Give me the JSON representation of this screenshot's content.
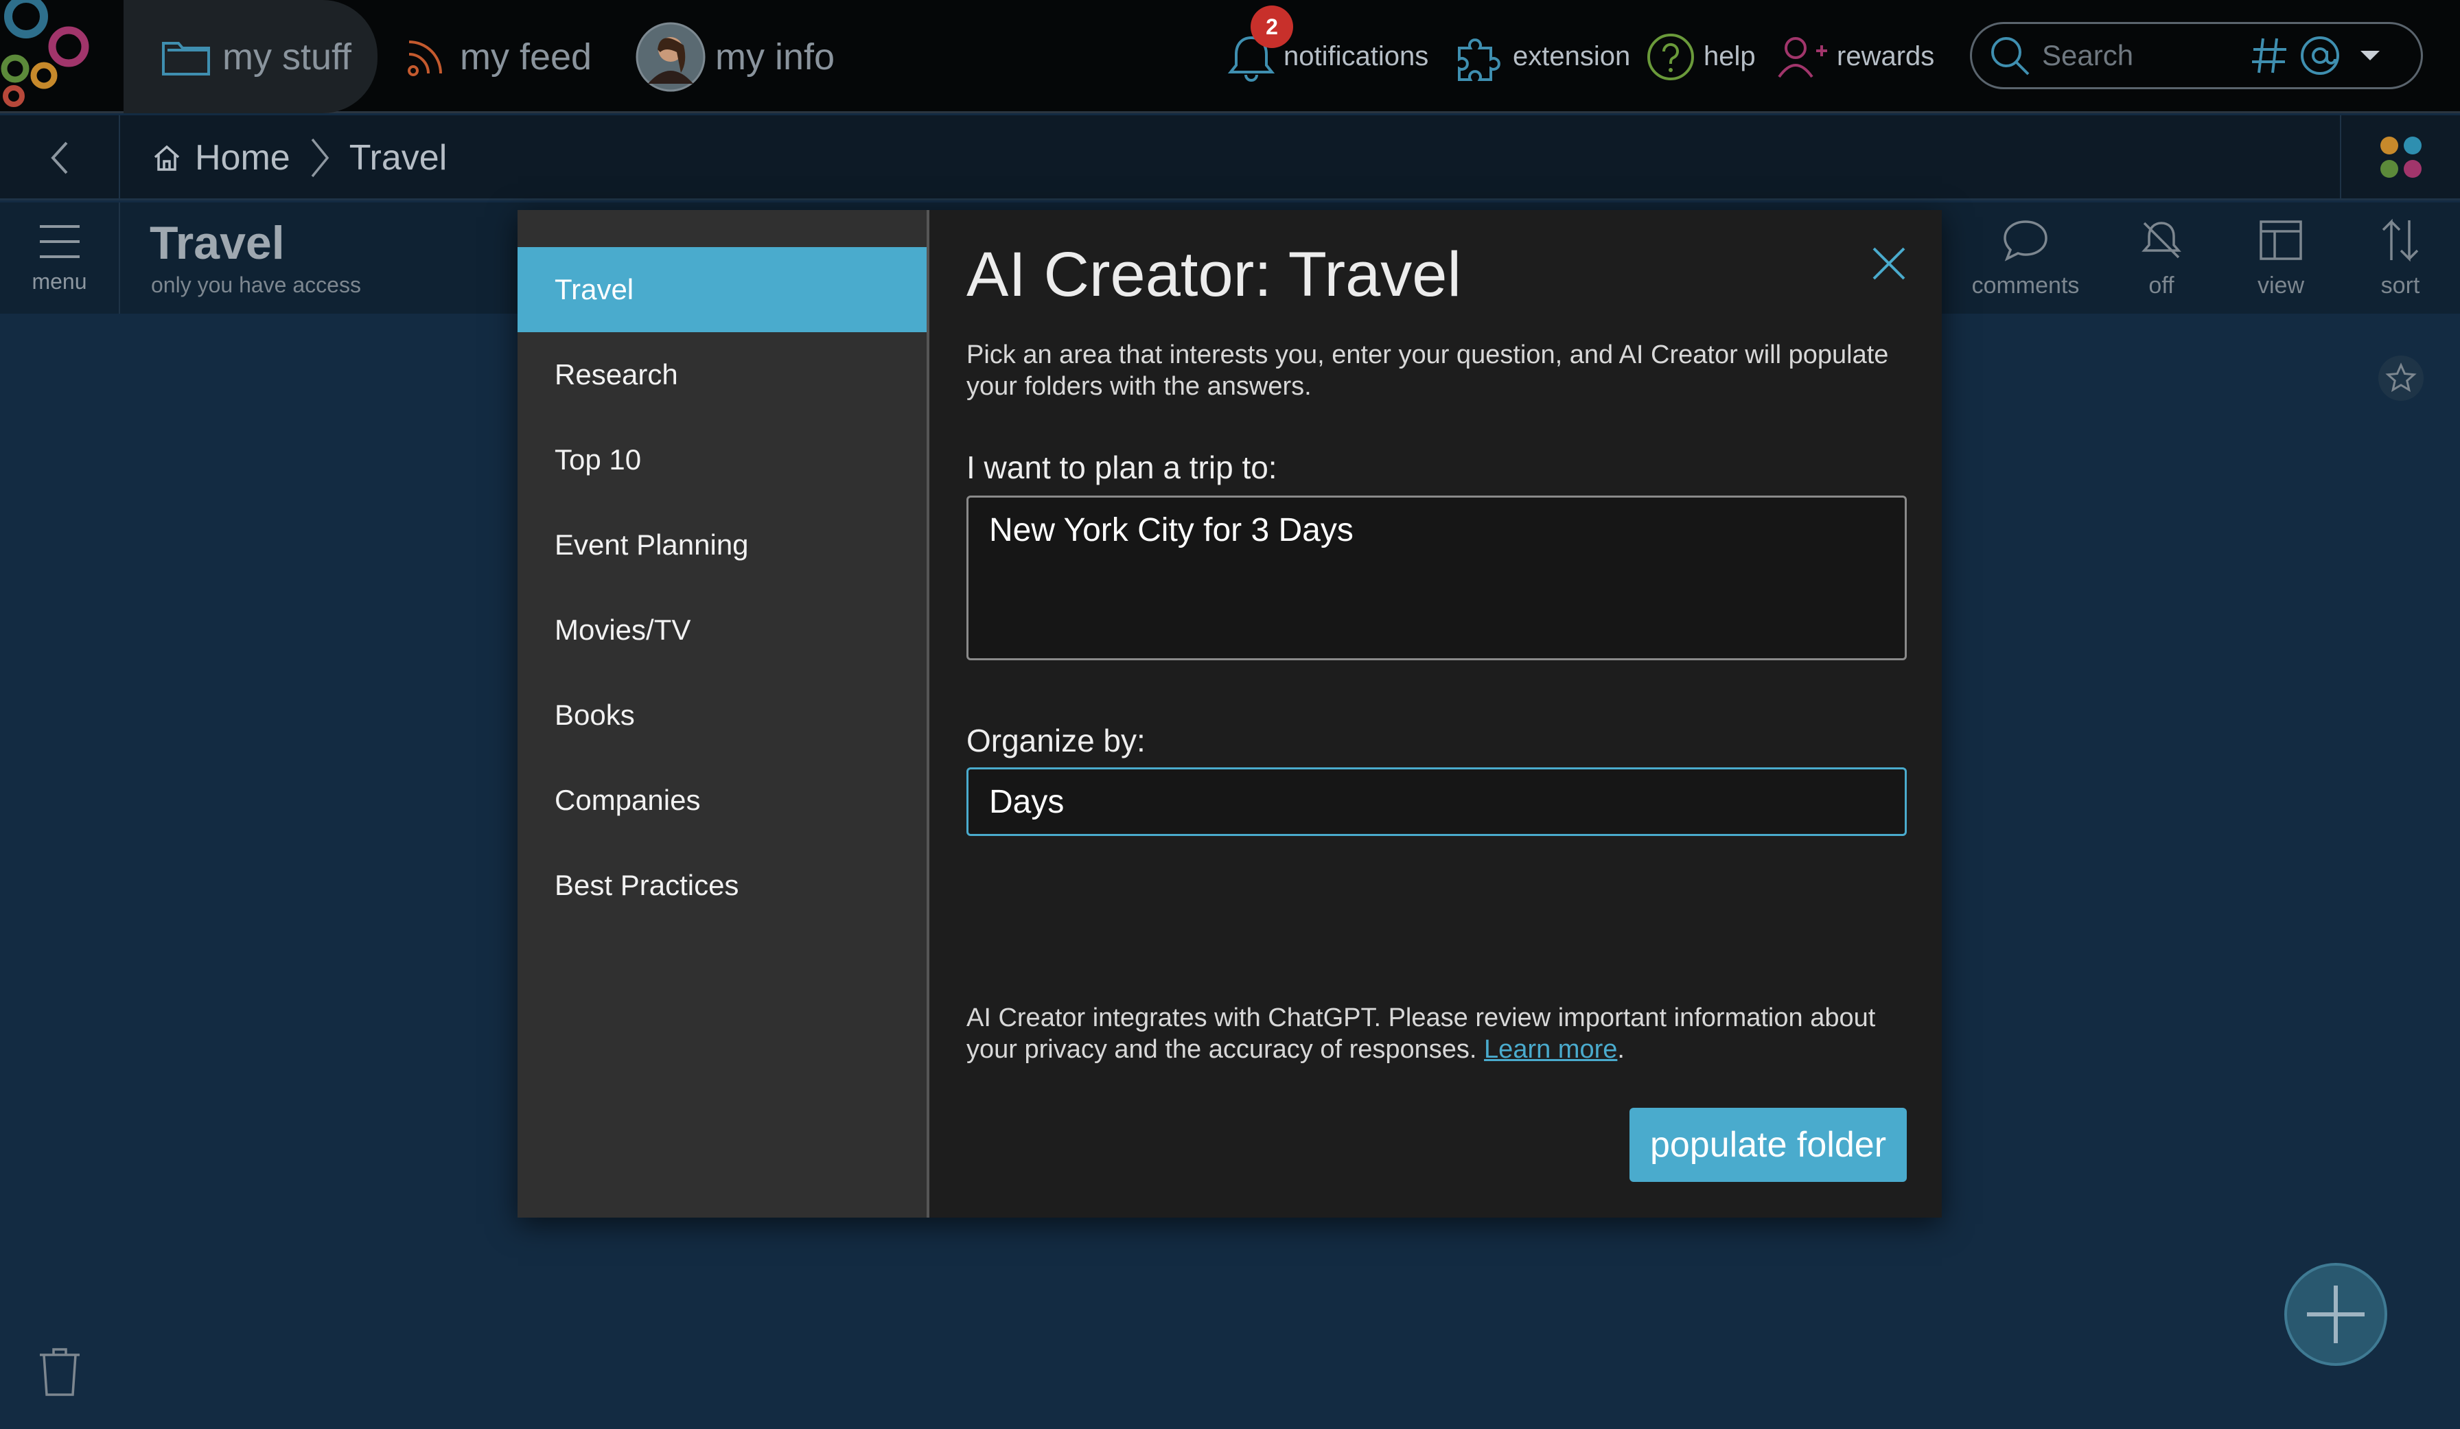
{
  "topnav": {
    "my_stuff": "my stuff",
    "my_feed": "my feed",
    "my_info": "my info",
    "notifications": "notifications",
    "notification_count": "2",
    "extension": "extension",
    "help": "help",
    "rewards": "rewards",
    "search_placeholder": "Search"
  },
  "breadcrumb": {
    "home": "Home",
    "current": "Travel"
  },
  "toolbar": {
    "menu": "menu",
    "title": "Travel",
    "subtitle": "only you have access",
    "comments": "comments",
    "off": "off",
    "view": "view",
    "sort": "sort"
  },
  "modal": {
    "title": "AI Creator: Travel",
    "intro": "Pick an area that interests you, enter your question, and AI Creator will populate your folders with the answers.",
    "sidebar": [
      {
        "label": "Travel",
        "active": true
      },
      {
        "label": "Research"
      },
      {
        "label": "Top 10"
      },
      {
        "label": "Event Planning"
      },
      {
        "label": "Movies/TV"
      },
      {
        "label": "Books"
      },
      {
        "label": "Companies"
      },
      {
        "label": "Best Practices"
      }
    ],
    "trip_label": "I want to plan a trip to:",
    "trip_value": "New York City for 3 Days",
    "organize_label": "Organize by:",
    "organize_value": "Days",
    "footnote": "AI Creator integrates with ChatGPT. Please review important information about your privacy and the accuracy of responses. ",
    "learn_more": "Learn more",
    "footnote_end": ".",
    "populate_button": "populate folder"
  },
  "colors": {
    "accent": "#4aabcd",
    "background": "#132b42",
    "nav_bg": "#050708",
    "modal_bg": "#1d1d1d",
    "sidebar_bg": "#303030",
    "badge": "#c8302b"
  },
  "icons": [
    "logo-rings",
    "folder-icon",
    "rss-icon",
    "avatar",
    "bell-icon",
    "puzzle-icon",
    "help-icon",
    "add-user-icon",
    "search-icon",
    "hashtag-icon",
    "at-icon",
    "dropdown-caret-icon",
    "back-chevron-icon",
    "home-icon",
    "chevron-right-icon",
    "apps-dots-icon",
    "hamburger-icon",
    "comment-icon",
    "notify-off-icon",
    "view-icon",
    "sort-icon",
    "star-icon",
    "trash-icon",
    "plus-icon",
    "close-icon"
  ]
}
